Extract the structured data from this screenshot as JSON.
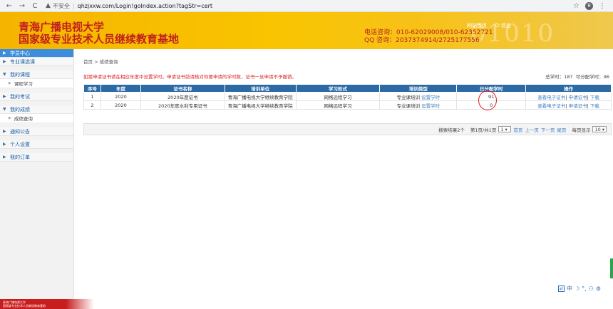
{
  "browser": {
    "back": "←",
    "forward": "→",
    "reload": "C",
    "insecure_label": "不安全",
    "url": "qhzjxxw.com/Login!goIndex.action?tagStr=cert",
    "star": "☆",
    "menu": "⋮",
    "profile": "θ"
  },
  "header": {
    "title_line1": "青海广播电视大学",
    "title_line2": "国家级专业技术人员继续教育基地",
    "link_home": "网站首页",
    "link_logout": "退出",
    "phone_line1": "电话咨询：010-62029008/010-62352721",
    "phone_line2": "QQ 咨询：2037374914/2725177556"
  },
  "sidebar": {
    "items": [
      {
        "label": "学员中心",
        "arrow": "▶",
        "active": true
      },
      {
        "label": "专业课选课",
        "arrow": "▶"
      },
      {
        "label": "我的课程",
        "arrow": "▼"
      },
      {
        "label": "课程学习",
        "sub": true
      },
      {
        "label": "我的考试",
        "arrow": "▶"
      },
      {
        "label": "我的成绩",
        "arrow": "▼"
      },
      {
        "label": "成绩查询",
        "sub": true
      },
      {
        "label": "通知公告",
        "arrow": "▶"
      },
      {
        "label": "个人设置",
        "arrow": "▶"
      },
      {
        "label": "我的订单",
        "arrow": "▶"
      }
    ]
  },
  "main": {
    "breadcrumb": "首页 > 成绩查询",
    "notice": "如需申请证书请在相应年度中设置学时。申请证书前请核对你要申请的学时数，证书一旦申请不予撤销。",
    "summary_total_label": "总学时：",
    "summary_total": "187",
    "summary_alloc_label": "可分配学时：",
    "summary_alloc": "96",
    "table": {
      "headers": [
        "序号",
        "年度",
        "证书名称",
        "培训单位",
        "学习形式",
        "培训类型",
        "已分配学时",
        "操作"
      ],
      "rows": [
        {
          "no": "1",
          "year": "2020",
          "cert": "2020年度证书",
          "unit": "青海广播电视大学继续教育学院",
          "form": "网络远程学习",
          "type": "专业课培训",
          "type_link": "设置学时",
          "hours": "91",
          "op1": "查看电子证书",
          "op2": "申请证书",
          "op3": "下载"
        },
        {
          "no": "2",
          "year": "2020",
          "cert": "2020年度水利专用证书",
          "unit": "青海广播电视大学继续教育学院",
          "form": "网络远程学习",
          "type": "专业课培训",
          "type_link": "设置学时",
          "hours": "0",
          "op1": "查看电子证书",
          "op2": "申请证书",
          "op3": "下载"
        }
      ]
    },
    "pager": {
      "result": "搜索结果2个",
      "page_info": "第1页/共1页",
      "page_select": "1",
      "first": "首页",
      "prev": "上一页",
      "next": "下一页",
      "last": "尾页",
      "per_page_label": "每页显示",
      "per_page": "10"
    }
  },
  "footer": {
    "line1": "青海广播电视大学",
    "line2": "国家级专业技术人员继续教育基地"
  },
  "ime": {
    "items": [
      "中",
      "☽",
      "°,",
      "⚇",
      "⚙"
    ]
  },
  "colors": {
    "banner": "#f9c400",
    "title_red": "#c0201d",
    "table_header": "#2c6aa6",
    "sidebar_active": "#3c8dde",
    "link": "#3c7fc4",
    "notice_red": "#dd2222"
  }
}
